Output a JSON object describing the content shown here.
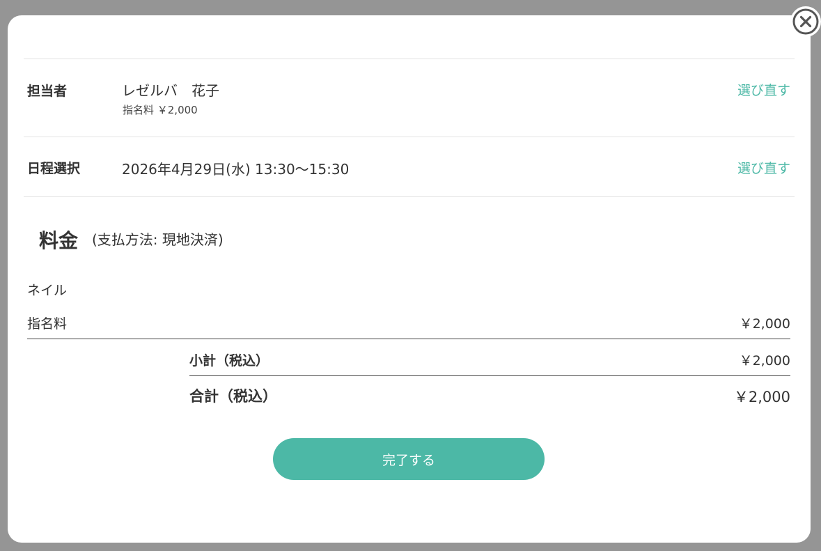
{
  "close": {
    "icon": "close-circle-icon"
  },
  "staff": {
    "label": "担当者",
    "name": "レゼルバ　花子",
    "fee_note": "指名料 ￥2,000",
    "reselect_label": "選び直す"
  },
  "schedule": {
    "label": "日程選択",
    "value": "2026年4月29日(水) 13:30〜15:30",
    "reselect_label": "選び直す"
  },
  "fees": {
    "title": "料金",
    "payment_method": "(支払方法: 現地決済)",
    "items": [
      {
        "label": "ネイル",
        "amount": ""
      },
      {
        "label": "指名料",
        "amount": "￥2,000"
      }
    ],
    "subtotal_label": "小計（税込）",
    "subtotal_amount": "￥2,000",
    "total_label": "合計（税込）",
    "total_amount": "￥2,000"
  },
  "actions": {
    "complete_label": "完了する"
  },
  "colors": {
    "accent": "#4cb8a6",
    "overlay": "#959595"
  }
}
